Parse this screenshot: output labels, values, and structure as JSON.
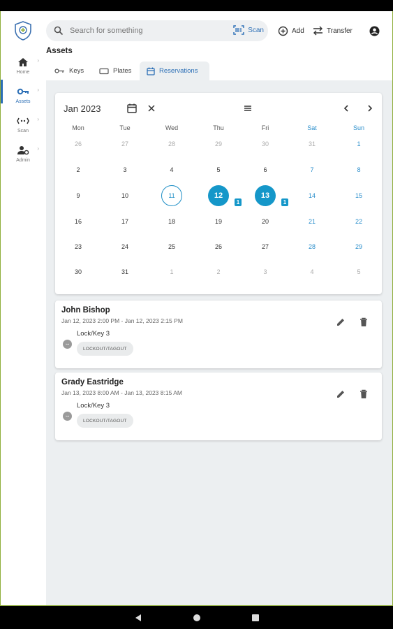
{
  "sidebar": {
    "items": [
      {
        "label": "Home",
        "icon": "home-icon"
      },
      {
        "label": "Assets",
        "icon": "key-icon",
        "active": true
      },
      {
        "label": "Scan",
        "icon": "scan-icon"
      },
      {
        "label": "Admin",
        "icon": "admin-icon"
      }
    ]
  },
  "header": {
    "search_placeholder": "Search for something",
    "scan_label": "Scan",
    "add_label": "Add",
    "transfer_label": "Transfer"
  },
  "page": {
    "title": "Assets",
    "tabs": [
      {
        "label": "Keys"
      },
      {
        "label": "Plates"
      },
      {
        "label": "Reservations",
        "active": true
      }
    ]
  },
  "calendar": {
    "month_label": "Jan 2023",
    "weekdays": [
      "Mon",
      "Tue",
      "Wed",
      "Thu",
      "Fri",
      "Sat",
      "Sun"
    ],
    "weeks": [
      [
        "26",
        "27",
        "28",
        "29",
        "30",
        "31",
        "1"
      ],
      [
        "2",
        "3",
        "4",
        "5",
        "6",
        "7",
        "8"
      ],
      [
        "9",
        "10",
        "11",
        "12",
        "13",
        "14",
        "15"
      ],
      [
        "16",
        "17",
        "18",
        "19",
        "20",
        "21",
        "22"
      ],
      [
        "23",
        "24",
        "25",
        "26",
        "27",
        "28",
        "29"
      ],
      [
        "30",
        "31",
        "1",
        "2",
        "3",
        "4",
        "5"
      ]
    ],
    "today": "11",
    "selected_days": [
      "12",
      "13"
    ],
    "badges": {
      "12": "1",
      "13": "1"
    }
  },
  "reservations": [
    {
      "name": "John Bishop",
      "range": "Jan 12, 2023 2:00 PM - Jan 12, 2023 2:15 PM",
      "asset": "Lock/Key 3",
      "tag": "LOCKOUT/TAGOUT"
    },
    {
      "name": "Grady Eastridge",
      "range": "Jan 13, 2023 8:00 AM - Jan 13, 2023 8:15 AM",
      "asset": "Lock/Key 3",
      "tag": "LOCKOUT/TAGOUT"
    }
  ],
  "colors": {
    "accent": "#2c6fb6",
    "selected_day": "#1597c9",
    "weekend": "#2c8fcc",
    "content_bg": "#eceff1"
  }
}
